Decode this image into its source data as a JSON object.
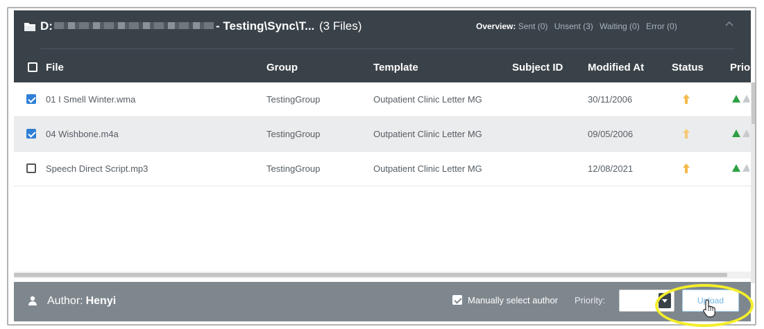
{
  "header": {
    "drive": "D:",
    "path_suffix": "- Testing\\Sync\\T...",
    "file_count": "(3 Files)",
    "overview_label": "Overview:",
    "sent": "Sent (0)",
    "unsent": "Unsent (3)",
    "waiting": "Waiting (0)",
    "error": "Error (0)"
  },
  "columns": {
    "file": "File",
    "group": "Group",
    "template": "Template",
    "subject_id": "Subject ID",
    "modified_at": "Modified At",
    "status": "Status",
    "priority": "Prior"
  },
  "rows": [
    {
      "file": "01 I Smell Winter.wma",
      "group": "TestingGroup",
      "template": "Outpatient Clinic Letter MG",
      "subject_id": "",
      "modified_at": "30/11/2006",
      "checked": true
    },
    {
      "file": "04 Wishbone.m4a",
      "group": "TestingGroup",
      "template": "Outpatient Clinic Letter MG",
      "subject_id": "",
      "modified_at": "09/05/2006",
      "checked": true
    },
    {
      "file": "Speech Direct Script.mp3",
      "group": "TestingGroup",
      "template": "Outpatient Clinic Letter MG",
      "subject_id": "",
      "modified_at": "12/08/2021",
      "checked": false
    }
  ],
  "footer": {
    "author_label": "Author:",
    "author_name": "Henyi",
    "manual_select_label": "Manually select author",
    "priority_label": "Priority:",
    "priority_value": "",
    "upload_label": "Upload"
  },
  "colors": {
    "header_bg": "#3a4249",
    "footer_bg": "#7f878e",
    "checkbox_blue": "#2f7fd6",
    "status_orange": "#f5a623",
    "priority_green": "#2ea043",
    "highlight_yellow": "#f3ee2a"
  },
  "icons": {
    "folder": "folder-icon",
    "collapse": "chevron-up-icon",
    "status": "upload-arrow-icon",
    "priority": "triangle-up-icon",
    "author": "person-icon",
    "cursor": "hand-pointer-icon"
  }
}
